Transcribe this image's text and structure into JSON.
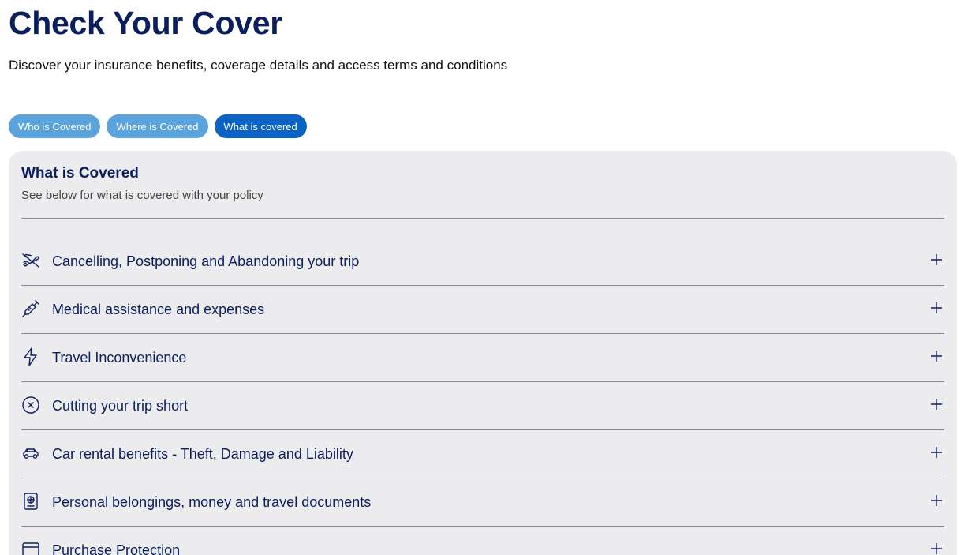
{
  "header": {
    "title": "Check Your Cover",
    "subtitle": "Discover your insurance benefits, coverage details and access terms and conditions"
  },
  "tabs": [
    {
      "label": "Who is Covered",
      "active": false
    },
    {
      "label": "Where is Covered",
      "active": false
    },
    {
      "label": "What is covered",
      "active": true
    }
  ],
  "panel": {
    "title": "What is Covered",
    "description": "See below for what is covered with your policy",
    "items": [
      {
        "label": "Cancelling, Postponing and Abandoning your trip",
        "icon": "plane-cancel-icon"
      },
      {
        "label": "Medical assistance and expenses",
        "icon": "syringe-icon"
      },
      {
        "label": "Travel Inconvenience",
        "icon": "lightning-icon"
      },
      {
        "label": "Cutting your trip short",
        "icon": "circle-x-icon"
      },
      {
        "label": "Car rental benefits - Theft, Damage and Liability",
        "icon": "car-icon"
      },
      {
        "label": "Personal belongings, money and travel documents",
        "icon": "passport-icon"
      },
      {
        "label": "Purchase Protection",
        "icon": "card-icon"
      }
    ]
  },
  "colors": {
    "heading": "#0b1f5c",
    "tab": "#5aa3dc",
    "tab_active": "#0a62c5",
    "panel_bg": "#ececef"
  }
}
